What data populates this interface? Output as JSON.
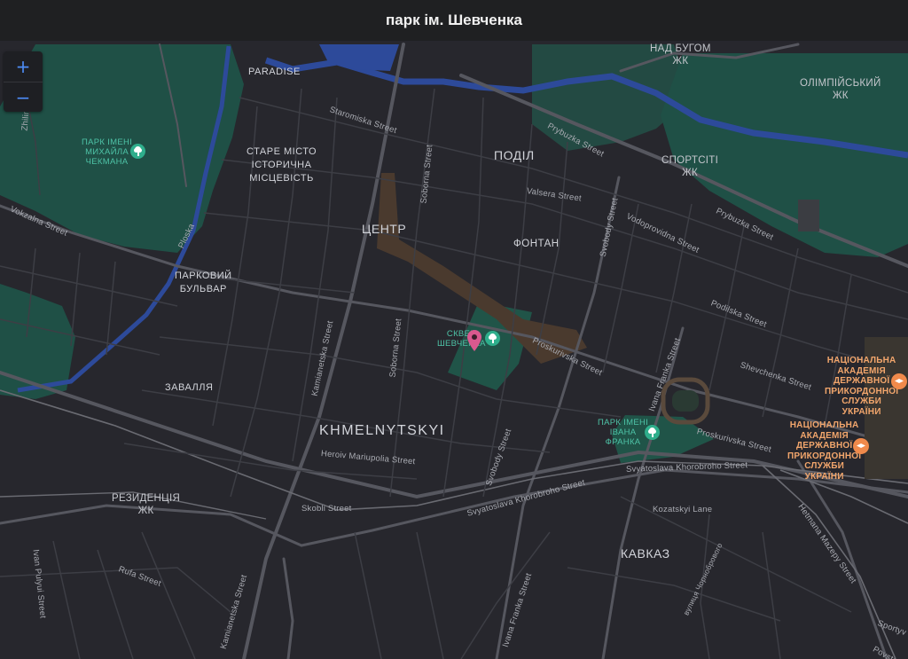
{
  "header": {
    "title": "парк ім. Шевченка"
  },
  "zoom": {
    "in": "+",
    "out": "−"
  },
  "colors": {
    "park": "#1f5046",
    "water": "#2d4a9a",
    "road": "#54555d",
    "rail": "#6a6b72",
    "pin": "#d9598f",
    "academy": "#f08a4b"
  },
  "districts": {
    "paradise": "PARADISE",
    "podil": "ПОДІЛ",
    "old_town": "СТАРЕ МІСТО\nІСТОРИЧНА\nМІСЦЕВІСТЬ",
    "centre": "ЦЕНТР",
    "fontan": "ФОНТАН",
    "parkovyi": "ПАРКОВИЙ\nБУЛЬВАР",
    "zavallia": "ЗАВАЛЛЯ",
    "khmelnytskyi": "KHMELNYTSKYI",
    "kavkaz": "КАВКАЗ"
  },
  "residential": {
    "nad_buhom": "НАД БУГОМ\nЖК",
    "olimpiiskyi": "ОЛІМПІЙСЬКИЙ\nЖК",
    "sportsiti": "СПОРТСІТІ\nЖК",
    "rezydentsiia": "РЕЗИДЕНЦІЯ\nЖК"
  },
  "parks": {
    "chekman": "ПАРК ІМЕНІ\nМИХАЙЛА\nЧЕКМАНА",
    "shevchenko": "СКВЕР\nШЕВЧЕНКА",
    "franko": "ПАРК ІМЕНІ\nІВАНА\nФРАНКА"
  },
  "academies": {
    "a1": "НАЦІОНАЛЬНА\nАКАДЕМІЯ\nДЕРЖАВНОЇ\nПРИКОРДОННОЇ\nСЛУЖБИ\nУКРАЇНИ",
    "a2": "НАЦІОНАЛЬНА\nАКАДЕМІЯ\nДЕРЖАВНОЇ\nПРИКОРДОННОЇ\nСЛУЖБИ\nУКРАЇНИ"
  },
  "streets": {
    "zhilina": "Zhilina Street",
    "staromiska": "Staromiska Street",
    "soborna_n": "Soborna Street",
    "soborna_s": "Soborna Street",
    "prybuzka_1": "Prybuzka Street",
    "prybuzka_2": "Prybuzka Street",
    "valsera": "Valsera Street",
    "svobody_n": "Svobody Street",
    "svobody_s": "Svobody Street",
    "vodoprovidna": "Vodoprovidna Street",
    "vokzalna": "Vokzalna Street",
    "ploska": "Ploska",
    "kamianetska_n": "Kamianetska Street",
    "kamianetska_s": "Kamianetska Street",
    "podilska": "Podilska Street",
    "proskurivska_1": "Proskurivska Street",
    "proskurivska_2": "Proskurivska Street",
    "ivana_franka_n": "Ivana Franka Street",
    "ivana_franka_s": "Ivana Franka Street",
    "shevchenka": "Shevchenka Street",
    "heroiv": "Heroiv Mariupolia Street",
    "svyatoslava_1": "Svyatoslava Khorobroho Street",
    "svyatoslava_2": "Svyatoslava Khorobroho Street",
    "skobli": "Skobli Street",
    "kozatskyi": "Kozatskyi Lane",
    "hetmana": "Hetmana Mazepy Street",
    "ivan_pulyui": "Ivan Pulyui Street",
    "rufa": "Rufa Street",
    "chornobrovoho": "вулиця Чорнобрового",
    "sportyvna": "Sportyv",
    "povstanska": "Povsta"
  }
}
